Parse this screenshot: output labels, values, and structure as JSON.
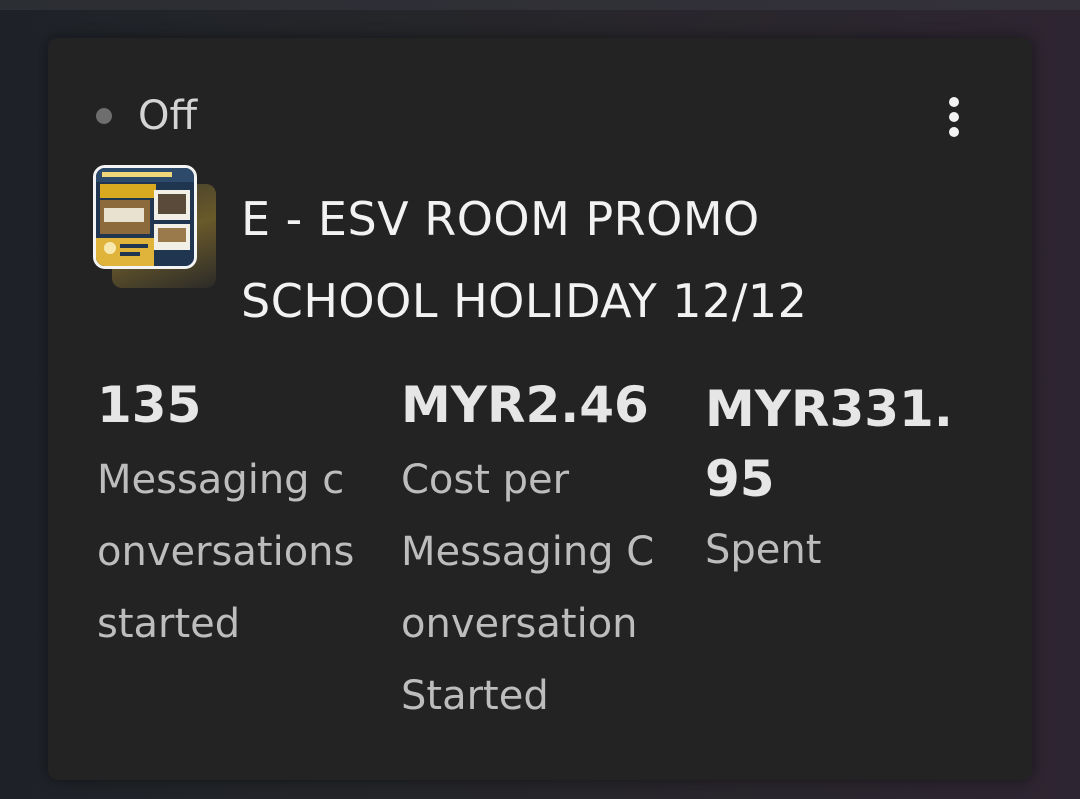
{
  "campaign": {
    "status": "Off",
    "name_line1": "E - ESV ROOM PROMO",
    "name_line2": "SCHOOL HOLIDAY 12/12",
    "thumbnail_icon": "ad-creative-thumbnail",
    "more_icon": "more-vertical-icon"
  },
  "metrics": [
    {
      "value": "135",
      "label_lines": [
        "Messaging c",
        "onversations",
        "started"
      ]
    },
    {
      "value": "MYR2.46",
      "label_lines": [
        "Cost per",
        "Messaging C",
        "onversation",
        "Started"
      ]
    },
    {
      "value_lines": [
        "MYR331.",
        "95"
      ],
      "label_lines": [
        "Spent"
      ]
    }
  ],
  "colors": {
    "card_background": "#232323",
    "status_dot": "#6e6e6e",
    "title_text": "#f2f2f2",
    "metric_value": "#e6e6e6",
    "metric_label": "#bdbdbd"
  }
}
